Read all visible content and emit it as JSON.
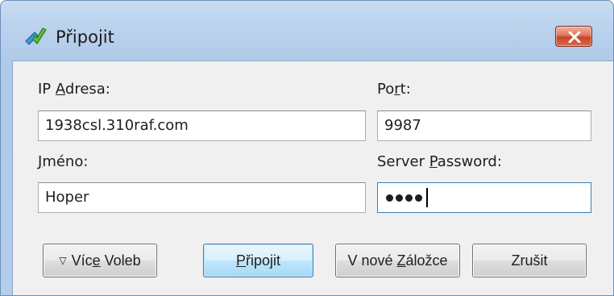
{
  "window": {
    "title": "Připojit",
    "icon": "connect-check-icon"
  },
  "form": {
    "ip": {
      "label_before": "IP ",
      "label_accel": "A",
      "label_after": "dresa:",
      "value": "1938csl.310raf.com"
    },
    "port": {
      "label_before": "Po",
      "label_accel": "r",
      "label_after": "t:",
      "value": "9987"
    },
    "name": {
      "label_before": "",
      "label_accel": "J",
      "label_after": "méno:",
      "value": "Hoper"
    },
    "password": {
      "label_before": "Server ",
      "label_accel": "P",
      "label_after": "assword:",
      "masked_length": 4
    }
  },
  "buttons": {
    "more_options": {
      "icon": "triangle-down-icon",
      "glyph": "▽",
      "label_before": "Víc",
      "label_accel": "e",
      "label_after": " Voleb"
    },
    "connect": {
      "label_before": "",
      "label_accel": "P",
      "label_after": "řipojit"
    },
    "new_tab": {
      "label_before": "V nové ",
      "label_accel": "Z",
      "label_after": "áložce"
    },
    "cancel": {
      "label": "Zrušit"
    }
  },
  "colors": {
    "frame": "#bcd3ee",
    "client": "#f0f0f0",
    "default_button": "#bee6fd",
    "close_button": "#c8442a"
  }
}
